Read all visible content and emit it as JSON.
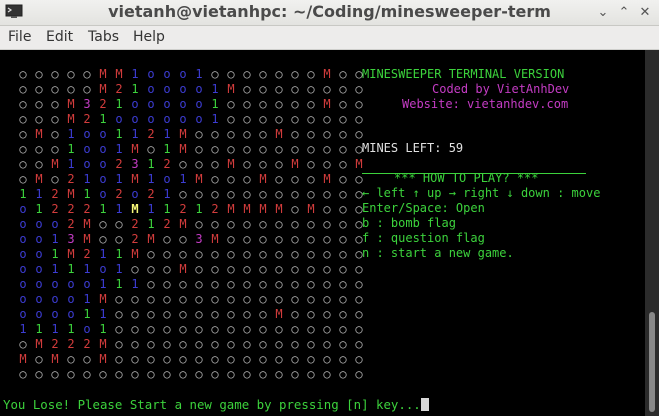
{
  "window": {
    "title": "vietanh@vietanhpc: ~/Coding/minesweeper-term"
  },
  "menu": [
    "File",
    "Edit",
    "Tabs",
    "Help"
  ],
  "colors": {
    "hidden": "#b8b8b8",
    "one_a": "#3cd23c",
    "one_b": "#3c3cd2",
    "mine": "#d23c3c",
    "two": "#d23c3c",
    "three": "#c43cc4",
    "highlight": "#f8f878",
    "green": "#3cd23c",
    "magenta": "#c43cc4"
  },
  "board_rows": [
    "○○○○○MM1ooo1○○○○○○○M○○",
    "○○○○○M21oooo1M○○○○○○○○",
    "○○○M321ooooo1○○○○○○M○○",
    "○○○M21oooooo1○○○○○○○○○",
    "○M○1oo1121M○○○○○M○○○○○",
    "○○○1oo1M○1M○○○○○○○○○○○",
    "○○M1oo2312○○○M○○○M○○○M",
    "○M○21o1M1o1M○○○M○○○M○○",
    "112M1o2o21○○○○○○○○○○○○",
    "o122211M11212MMMM○M○○○",
    "ooo2M○○212M○○○○○○○○○○○",
    "oo13M○○2M○○3M○○○○○○○○○",
    "oo1M211M○○○○○○○○○○○○○○",
    "oo111o1○○○M○○○○○○○○○○○",
    "ooooo111○○○○○○○○○○○○○○",
    "oooo1M○○○○○○○○○○○○○○○○",
    "oooo11○○○○○○○○○○M○○○○○",
    "1111o1○○○○○○○○○○○○○○○○",
    "○M222M○○○○○○○○○○○○○○○○",
    "M○M○○M○○○○○○○○○○○○○○○○",
    "○○○○○○○○○○○○○○○○○○○○○○"
  ],
  "info": {
    "title": "MINESWEEPER TERMINAL VERSION",
    "coded_by": "Coded by VietAnhDev",
    "website": "Website: vietanhdev.com",
    "mines_left": "MINES LEFT: 59",
    "howto": "*** HOW TO PLAY? ***",
    "keys": "← left ↑ up → right ↓ down : move",
    "open": "Enter/Space: Open",
    "bomb": "b : bomb flag",
    "question": "f : question flag",
    "newgame": "n : start a new game."
  },
  "status_line": "You Lose! Please Start a new game by pressing [n] key..."
}
